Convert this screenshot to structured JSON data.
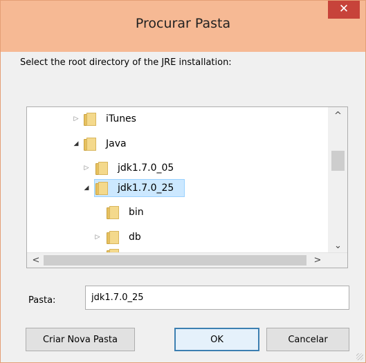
{
  "window": {
    "title": "Procurar Pasta",
    "close_glyph": "✕"
  },
  "dialog": {
    "instruction": "Select the root directory of the JRE installation:",
    "tree": {
      "items": [
        {
          "label": "iTunes",
          "state": "collapsed",
          "icon": "folder-icon"
        },
        {
          "label": "Java",
          "state": "expanded",
          "icon": "folder-icon"
        },
        {
          "label": "jdk1.7.0_05",
          "state": "collapsed",
          "icon": "folder-icon"
        },
        {
          "label": "jdk1.7.0_25",
          "state": "expanded",
          "icon": "folder-icon",
          "selected": true
        },
        {
          "label": "bin",
          "state": "leaf",
          "icon": "folder-icon"
        },
        {
          "label": "db",
          "state": "collapsed",
          "icon": "folder-icon"
        }
      ]
    },
    "folder_field": {
      "label": "Pasta:",
      "value": "jdk1.7.0_25"
    },
    "buttons": {
      "new_folder": "Criar Nova Pasta",
      "ok": "OK",
      "cancel": "Cancelar"
    }
  },
  "glyphs": {
    "collapsed": "▷",
    "expanded": "◢",
    "scroll_up": "^",
    "scroll_down": "⌄",
    "scroll_left": "<",
    "scroll_right": ">"
  },
  "colors": {
    "titlebar": "#f6b994",
    "close_button": "#c7433a",
    "selection": "#cce8ff",
    "selection_border": "#99d1ff",
    "default_button_border": "#3c7fb1"
  }
}
